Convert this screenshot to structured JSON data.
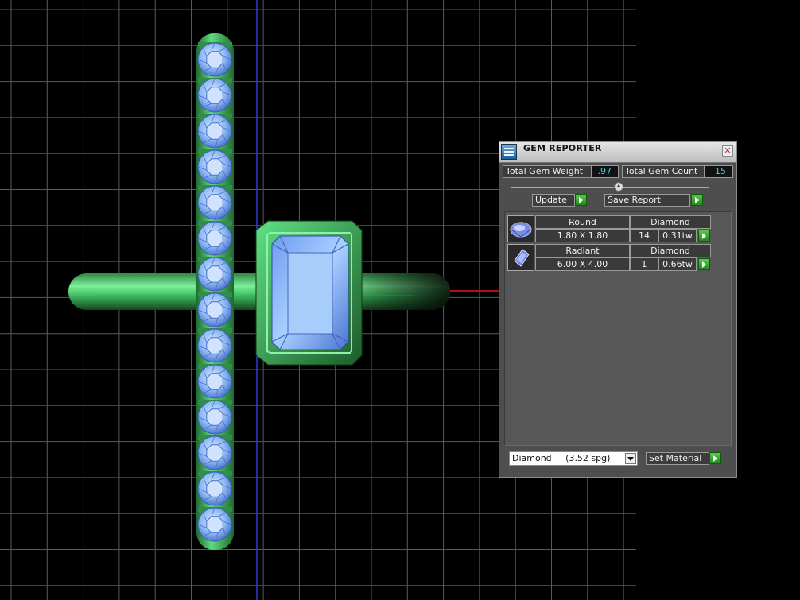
{
  "viewport": {
    "grid_color": "#5a5a5a",
    "axis_y_color": "#2a3fd0",
    "axis_x_color": "#b01010",
    "metal_color": "#3fbf62",
    "gem_color": "#8fc3ff"
  },
  "gem_reporter": {
    "title": "GEM REPORTER",
    "icon": "gem-reporter-icon",
    "close_icon": "close-icon",
    "total_weight_label": "Total Gem Weight",
    "total_weight_value": ".97",
    "total_count_label": "Total Gem Count",
    "total_count_value": "15",
    "update_label": "Update",
    "save_report_label": "Save Report",
    "gems": [
      {
        "thumb_icon": "round-gem-icon",
        "shape": "Round",
        "material": "Diamond",
        "size": "1.80 X 1.80",
        "count": "14",
        "weight": "0.31tw"
      },
      {
        "thumb_icon": "radiant-gem-icon",
        "shape": "Radiant",
        "material": "Diamond",
        "size": "6.00 X 4.00",
        "count": "1",
        "weight": "0.66tw"
      }
    ],
    "material_select": "Diamond     (3.52 spg)",
    "set_material_label": "Set Material",
    "accent_value_color": "#41d1e6",
    "go_button_color": "#2fa82a"
  }
}
